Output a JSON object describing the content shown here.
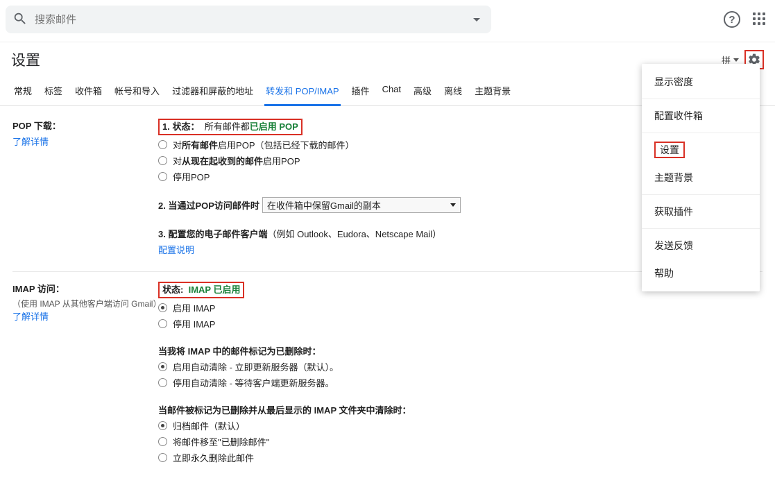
{
  "search": {
    "placeholder": "搜索邮件"
  },
  "ime": {
    "label": "拼"
  },
  "page_title": "设置",
  "tabs": {
    "general": "常规",
    "labels": "标签",
    "inbox": "收件箱",
    "accounts": "帐号和导入",
    "filters": "过滤器和屏蔽的地址",
    "forwarding": "转发和 POP/IMAP",
    "addons": "插件",
    "chat": "Chat",
    "advanced": "高级",
    "offline": "离线",
    "themes": "主题背景"
  },
  "pop": {
    "heading": "POP 下载：",
    "learn": "了解详情",
    "status_label": "1. 状态：",
    "status_prefix": "所有邮件都",
    "status_enabled": "已启用 POP",
    "opt_all_pre": "对",
    "opt_all_bold": "所有邮件",
    "opt_all_post": "启用POP（包括已经下载的邮件）",
    "opt_now_pre": "对",
    "opt_now_bold": "从现在起收到的邮件",
    "opt_now_post": "启用POP",
    "opt_disable": "停用POP",
    "access_label": "2. 当通过POP访问邮件时",
    "access_select": "在收件箱中保留Gmail的副本",
    "config_label": "3. 配置您的电子邮件客户端",
    "config_example": "（例如 Outlook、Eudora、Netscape Mail）",
    "config_link": "配置说明"
  },
  "imap": {
    "heading": "IMAP 访问：",
    "sub": "（使用 IMAP 从其他客户端访问 Gmail）",
    "learn": "了解详情",
    "status_label": "状态:",
    "status_value": "IMAP 已启用",
    "opt_enable": "启用 IMAP",
    "opt_disable": "停用 IMAP",
    "delete_heading": "当我将 IMAP 中的邮件标记为已删除时：",
    "delete_auto_on": "启用自动清除 - 立即更新服务器（默认）。",
    "delete_auto_off": "停用自动清除 - 等待客户端更新服务器。",
    "last_heading": "当邮件被标记为已删除并从最后显示的 IMAP 文件夹中清除时：",
    "last_archive": "归档邮件（默认）",
    "last_move": "将邮件移至\"已删除邮件\"",
    "last_perm": "立即永久删除此邮件"
  },
  "menu": {
    "density": "显示密度",
    "config_inbox": "配置收件箱",
    "settings": "设置",
    "themes": "主题背景",
    "get_addons": "获取插件",
    "feedback": "发送反馈",
    "help": "帮助"
  }
}
